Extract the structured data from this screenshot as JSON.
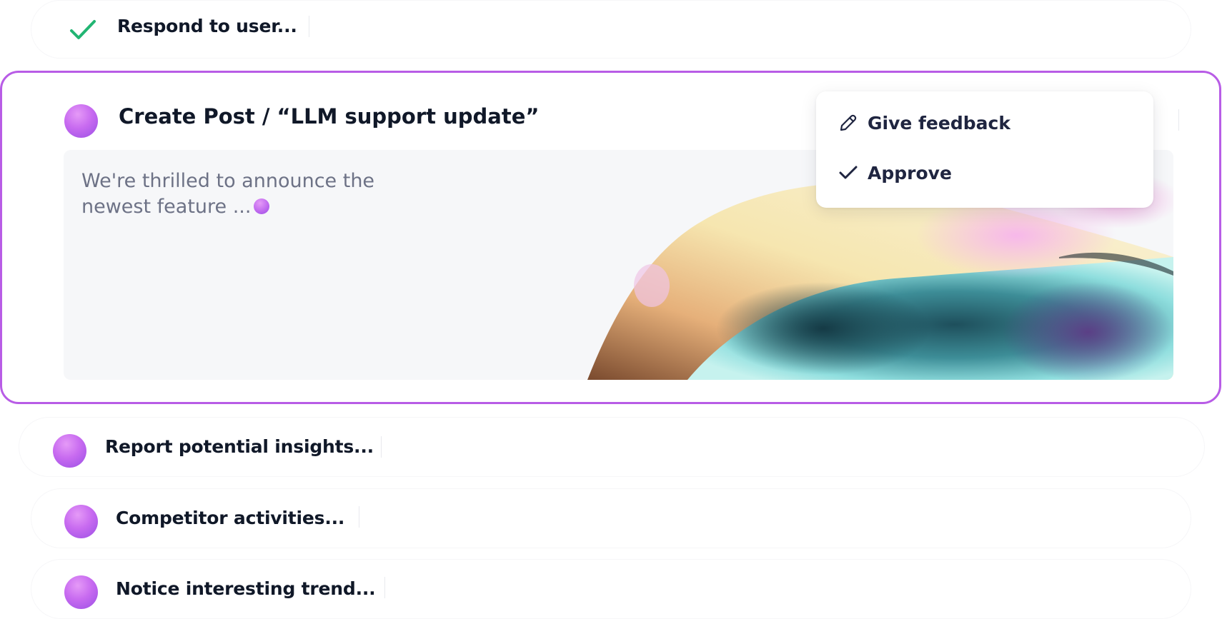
{
  "tasks": [
    {
      "title": "Respond to user...",
      "status": "done"
    },
    {
      "title": "Create Post / “LLM support update”",
      "status": "active"
    },
    {
      "title": "Report potential insights...",
      "status": "pending"
    },
    {
      "title": "Competitor activities...",
      "status": "pending"
    },
    {
      "title": "Notice interesting trend...",
      "status": "pending"
    }
  ],
  "post_preview": {
    "text": "We're thrilled to announce the newest feature ..."
  },
  "context_menu": {
    "items": [
      {
        "label": "Give feedback",
        "icon": "pencil-icon"
      },
      {
        "label": "Approve",
        "icon": "check-icon"
      }
    ]
  },
  "colors": {
    "accent": "#b85ce6",
    "success": "#22b573",
    "orb": "#c86bf0",
    "text": "#101828"
  }
}
